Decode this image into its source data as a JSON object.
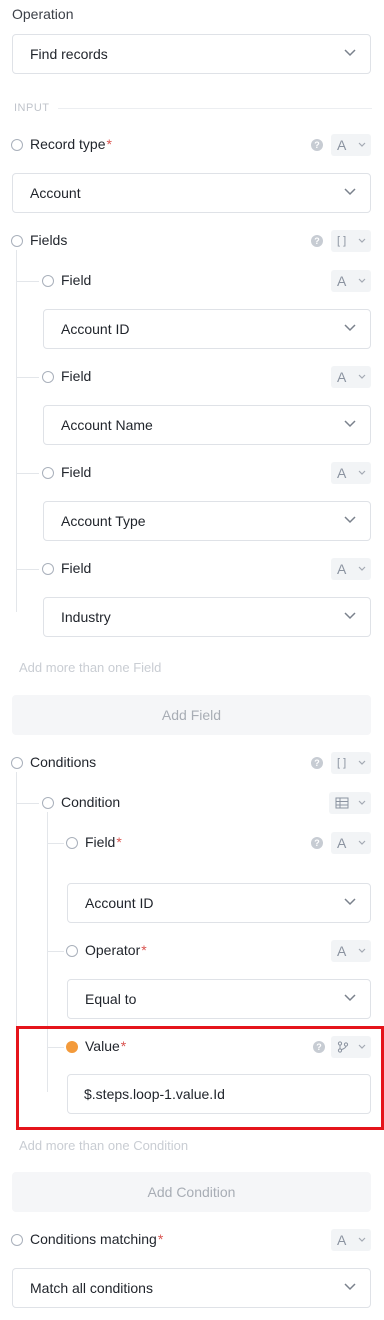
{
  "operation": {
    "label": "Operation",
    "value": "Find records"
  },
  "section_label": "INPUT",
  "record_type": {
    "label": "Record type",
    "required": "*",
    "type_glyph": "A",
    "value": "Account"
  },
  "fields": {
    "label": "Fields",
    "type_glyph": "[ ]",
    "items": [
      {
        "label": "Field",
        "type_glyph": "A",
        "value": "Account ID"
      },
      {
        "label": "Field",
        "type_glyph": "A",
        "value": "Account Name"
      },
      {
        "label": "Field",
        "type_glyph": "A",
        "value": "Account Type"
      },
      {
        "label": "Field",
        "type_glyph": "A",
        "value": "Industry"
      }
    ],
    "hint": "Add more than one Field",
    "add_button": "Add Field"
  },
  "conditions": {
    "label": "Conditions",
    "type_glyph": "[ ]",
    "condition": {
      "label": "Condition",
      "field": {
        "label": "Field",
        "required": "*",
        "type_glyph": "A",
        "value": "Account ID"
      },
      "operator": {
        "label": "Operator",
        "required": "*",
        "type_glyph": "A",
        "value": "Equal to"
      },
      "value": {
        "label": "Value",
        "required": "*",
        "value": "$.steps.loop-1.value.Id"
      }
    },
    "hint": "Add more than one Condition",
    "add_button": "Add Condition"
  },
  "conditions_matching": {
    "label": "Conditions matching",
    "required": "*",
    "type_glyph": "A",
    "value": "Match all conditions"
  },
  "colors": {
    "accent_orange": "#f39a3b",
    "required_red": "#d9534f",
    "highlight_red": "#e5141b"
  }
}
